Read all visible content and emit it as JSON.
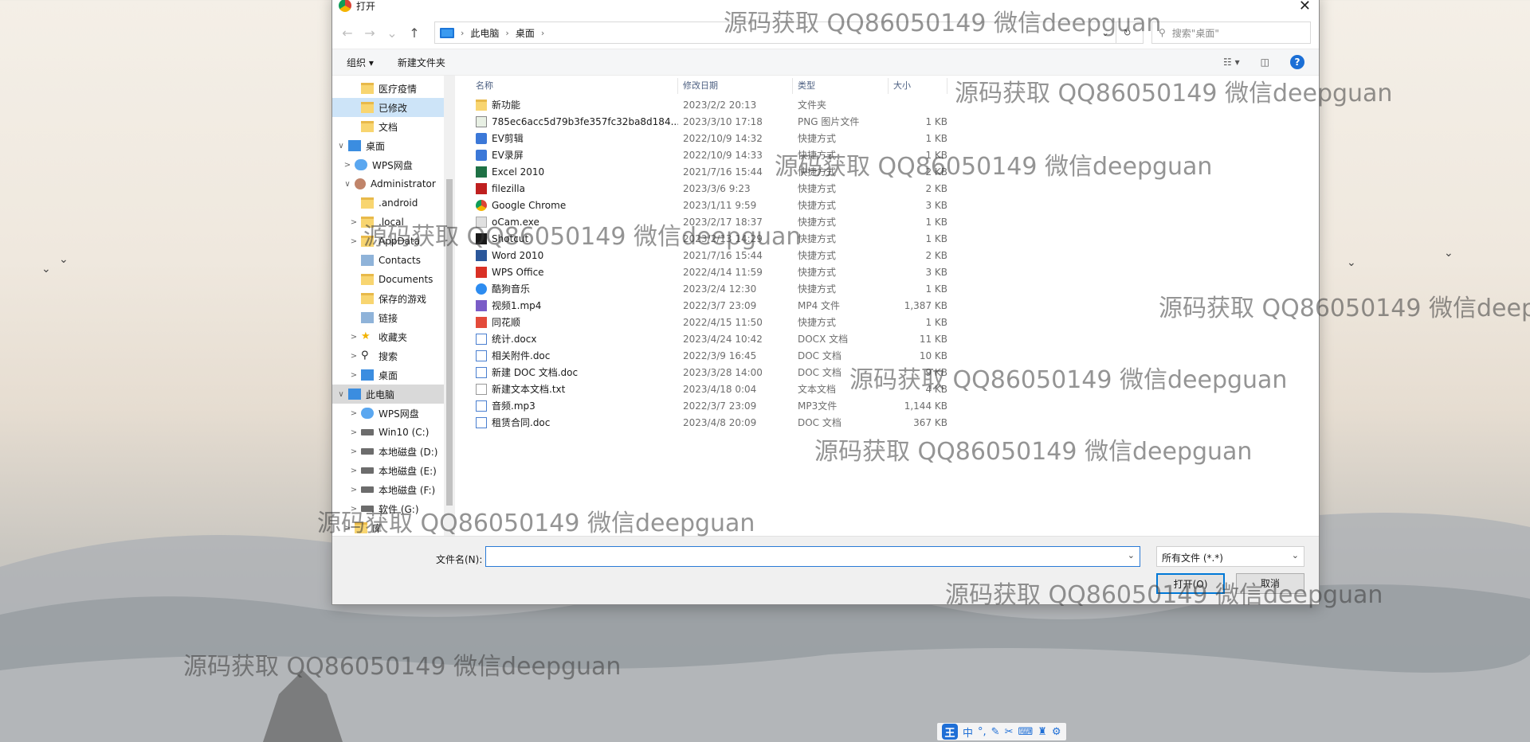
{
  "dialog": {
    "title": "打开",
    "breadcrumbs": [
      "此电脑",
      "桌面"
    ],
    "search_placeholder": "搜索\"桌面\"",
    "toolbar": {
      "organize": "组织 ▾",
      "new_folder": "新建文件夹"
    },
    "nav_items": [
      {
        "label": "医疗疫情",
        "icon": "folder-icon",
        "indent": 2,
        "chev": "",
        "state": ""
      },
      {
        "label": "已修改",
        "icon": "folder-icon",
        "indent": 2,
        "chev": "",
        "state": "selected"
      },
      {
        "label": "文档",
        "icon": "folder-icon",
        "indent": 2,
        "chev": "",
        "state": ""
      },
      {
        "label": "桌面",
        "icon": "desktop-icon",
        "indent": 0,
        "chev": "∨",
        "state": ""
      },
      {
        "label": "WPS网盘",
        "icon": "cloud-icon",
        "indent": 1,
        "chev": ">",
        "state": ""
      },
      {
        "label": "Administrator",
        "icon": "user-icon",
        "indent": 1,
        "chev": "∨",
        "state": ""
      },
      {
        "label": ".android",
        "icon": "folder-icon",
        "indent": 2,
        "chev": "",
        "state": ""
      },
      {
        "label": ".local",
        "icon": "folder-icon",
        "indent": 2,
        "chev": ">",
        "state": ""
      },
      {
        "label": "AppData",
        "icon": "folder-icon",
        "indent": 2,
        "chev": ">",
        "state": ""
      },
      {
        "label": "Contacts",
        "icon": "contacts-icon",
        "indent": 2,
        "chev": "",
        "state": ""
      },
      {
        "label": "Documents",
        "icon": "folder-icon",
        "indent": 2,
        "chev": "",
        "state": ""
      },
      {
        "label": "保存的游戏",
        "icon": "folder-icon",
        "indent": 2,
        "chev": "",
        "state": ""
      },
      {
        "label": "链接",
        "icon": "link-icon",
        "indent": 2,
        "chev": "",
        "state": ""
      },
      {
        "label": "收藏夹",
        "icon": "star-icon",
        "indent": 2,
        "chev": ">",
        "state": ""
      },
      {
        "label": "搜索",
        "icon": "search-icon",
        "indent": 2,
        "chev": ">",
        "state": ""
      },
      {
        "label": "桌面",
        "icon": "desktop-icon",
        "indent": 2,
        "chev": ">",
        "state": ""
      },
      {
        "label": "此电脑",
        "icon": "pc-icon",
        "indent": 0,
        "chev": "∨",
        "state": "selected-gray"
      },
      {
        "label": "WPS网盘",
        "icon": "cloud-icon",
        "indent": 2,
        "chev": ">",
        "state": ""
      },
      {
        "label": "Win10 (C:)",
        "icon": "drive-icon",
        "indent": 2,
        "chev": ">",
        "state": ""
      },
      {
        "label": "本地磁盘 (D:)",
        "icon": "drive-icon",
        "indent": 2,
        "chev": ">",
        "state": ""
      },
      {
        "label": "本地磁盘 (E:)",
        "icon": "drive-icon",
        "indent": 2,
        "chev": ">",
        "state": ""
      },
      {
        "label": "本地磁盘 (F:)",
        "icon": "drive-icon",
        "indent": 2,
        "chev": ">",
        "state": ""
      },
      {
        "label": "软件 (G:)",
        "icon": "drive-icon",
        "indent": 2,
        "chev": ">",
        "state": ""
      },
      {
        "label": "库",
        "icon": "folder-icon",
        "indent": 1,
        "chev": ">",
        "state": ""
      }
    ],
    "columns": {
      "name": "名称",
      "date": "修改日期",
      "type": "类型",
      "size": "大小"
    },
    "files": [
      {
        "name": "新功能",
        "date": "2023/2/2 20:13",
        "type": "文件夹",
        "size": "",
        "icon": "f-folder"
      },
      {
        "name": "785ec6acc5d79b3fe357fc32ba8d184...",
        "date": "2023/3/10 17:18",
        "type": "PNG 图片文件",
        "size": "1 KB",
        "icon": "f-png"
      },
      {
        "name": "EV剪辑",
        "date": "2022/10/9 14:32",
        "type": "快捷方式",
        "size": "1 KB",
        "icon": "f-ev"
      },
      {
        "name": "EV录屏",
        "date": "2022/10/9 14:33",
        "type": "快捷方式",
        "size": "1 KB",
        "icon": "f-ev"
      },
      {
        "name": "Excel 2010",
        "date": "2021/7/16 15:44",
        "type": "快捷方式",
        "size": "2 KB",
        "icon": "f-excel"
      },
      {
        "name": "filezilla",
        "date": "2023/3/6 9:23",
        "type": "快捷方式",
        "size": "2 KB",
        "icon": "f-fz"
      },
      {
        "name": "Google Chrome",
        "date": "2023/1/11 9:59",
        "type": "快捷方式",
        "size": "3 KB",
        "icon": "f-chrome"
      },
      {
        "name": "oCam.exe",
        "date": "2023/2/17 18:37",
        "type": "快捷方式",
        "size": "1 KB",
        "icon": "f-exe"
      },
      {
        "name": "Shotcut",
        "date": "2023/2/13 14:29",
        "type": "快捷方式",
        "size": "1 KB",
        "icon": "f-shot"
      },
      {
        "name": "Word 2010",
        "date": "2021/7/16 15:44",
        "type": "快捷方式",
        "size": "2 KB",
        "icon": "f-word"
      },
      {
        "name": "WPS Office",
        "date": "2022/4/14 11:59",
        "type": "快捷方式",
        "size": "3 KB",
        "icon": "f-wps"
      },
      {
        "name": "酷狗音乐",
        "date": "2023/2/4 12:30",
        "type": "快捷方式",
        "size": "1 KB",
        "icon": "f-music"
      },
      {
        "name": "视频1.mp4",
        "date": "2022/3/7 23:09",
        "type": "MP4 文件",
        "size": "1,387 KB",
        "icon": "f-mp4"
      },
      {
        "name": "同花顺",
        "date": "2022/4/15 11:50",
        "type": "快捷方式",
        "size": "1 KB",
        "icon": "f-ths"
      },
      {
        "name": "统计.docx",
        "date": "2023/4/24 10:42",
        "type": "DOCX 文档",
        "size": "11 KB",
        "icon": "f-doc"
      },
      {
        "name": "相关附件.doc",
        "date": "2022/3/9 16:45",
        "type": "DOC 文档",
        "size": "10 KB",
        "icon": "f-doc"
      },
      {
        "name": "新建 DOC 文档.doc",
        "date": "2023/3/28 14:00",
        "type": "DOC 文档",
        "size": "9 KB",
        "icon": "f-doc"
      },
      {
        "name": "新建文本文档.txt",
        "date": "2023/4/18 0:04",
        "type": "文本文档",
        "size": "4 KB",
        "icon": "f-txt"
      },
      {
        "name": "音频.mp3",
        "date": "2022/3/7 23:09",
        "type": "MP3文件",
        "size": "1,144 KB",
        "icon": "f-mp3"
      },
      {
        "name": "租赁合同.doc",
        "date": "2023/4/8 20:09",
        "type": "DOC 文档",
        "size": "367 KB",
        "icon": "f-doc"
      }
    ],
    "filename_label": "文件名(N):",
    "filename_value": "",
    "filter_value": "所有文件 (*.*)",
    "open_button": "打开(O)",
    "cancel_button": "取消"
  },
  "watermark_text": "源码获取 QQ86050149 微信deepguan",
  "ime": {
    "logo": "王",
    "mode": "中"
  }
}
